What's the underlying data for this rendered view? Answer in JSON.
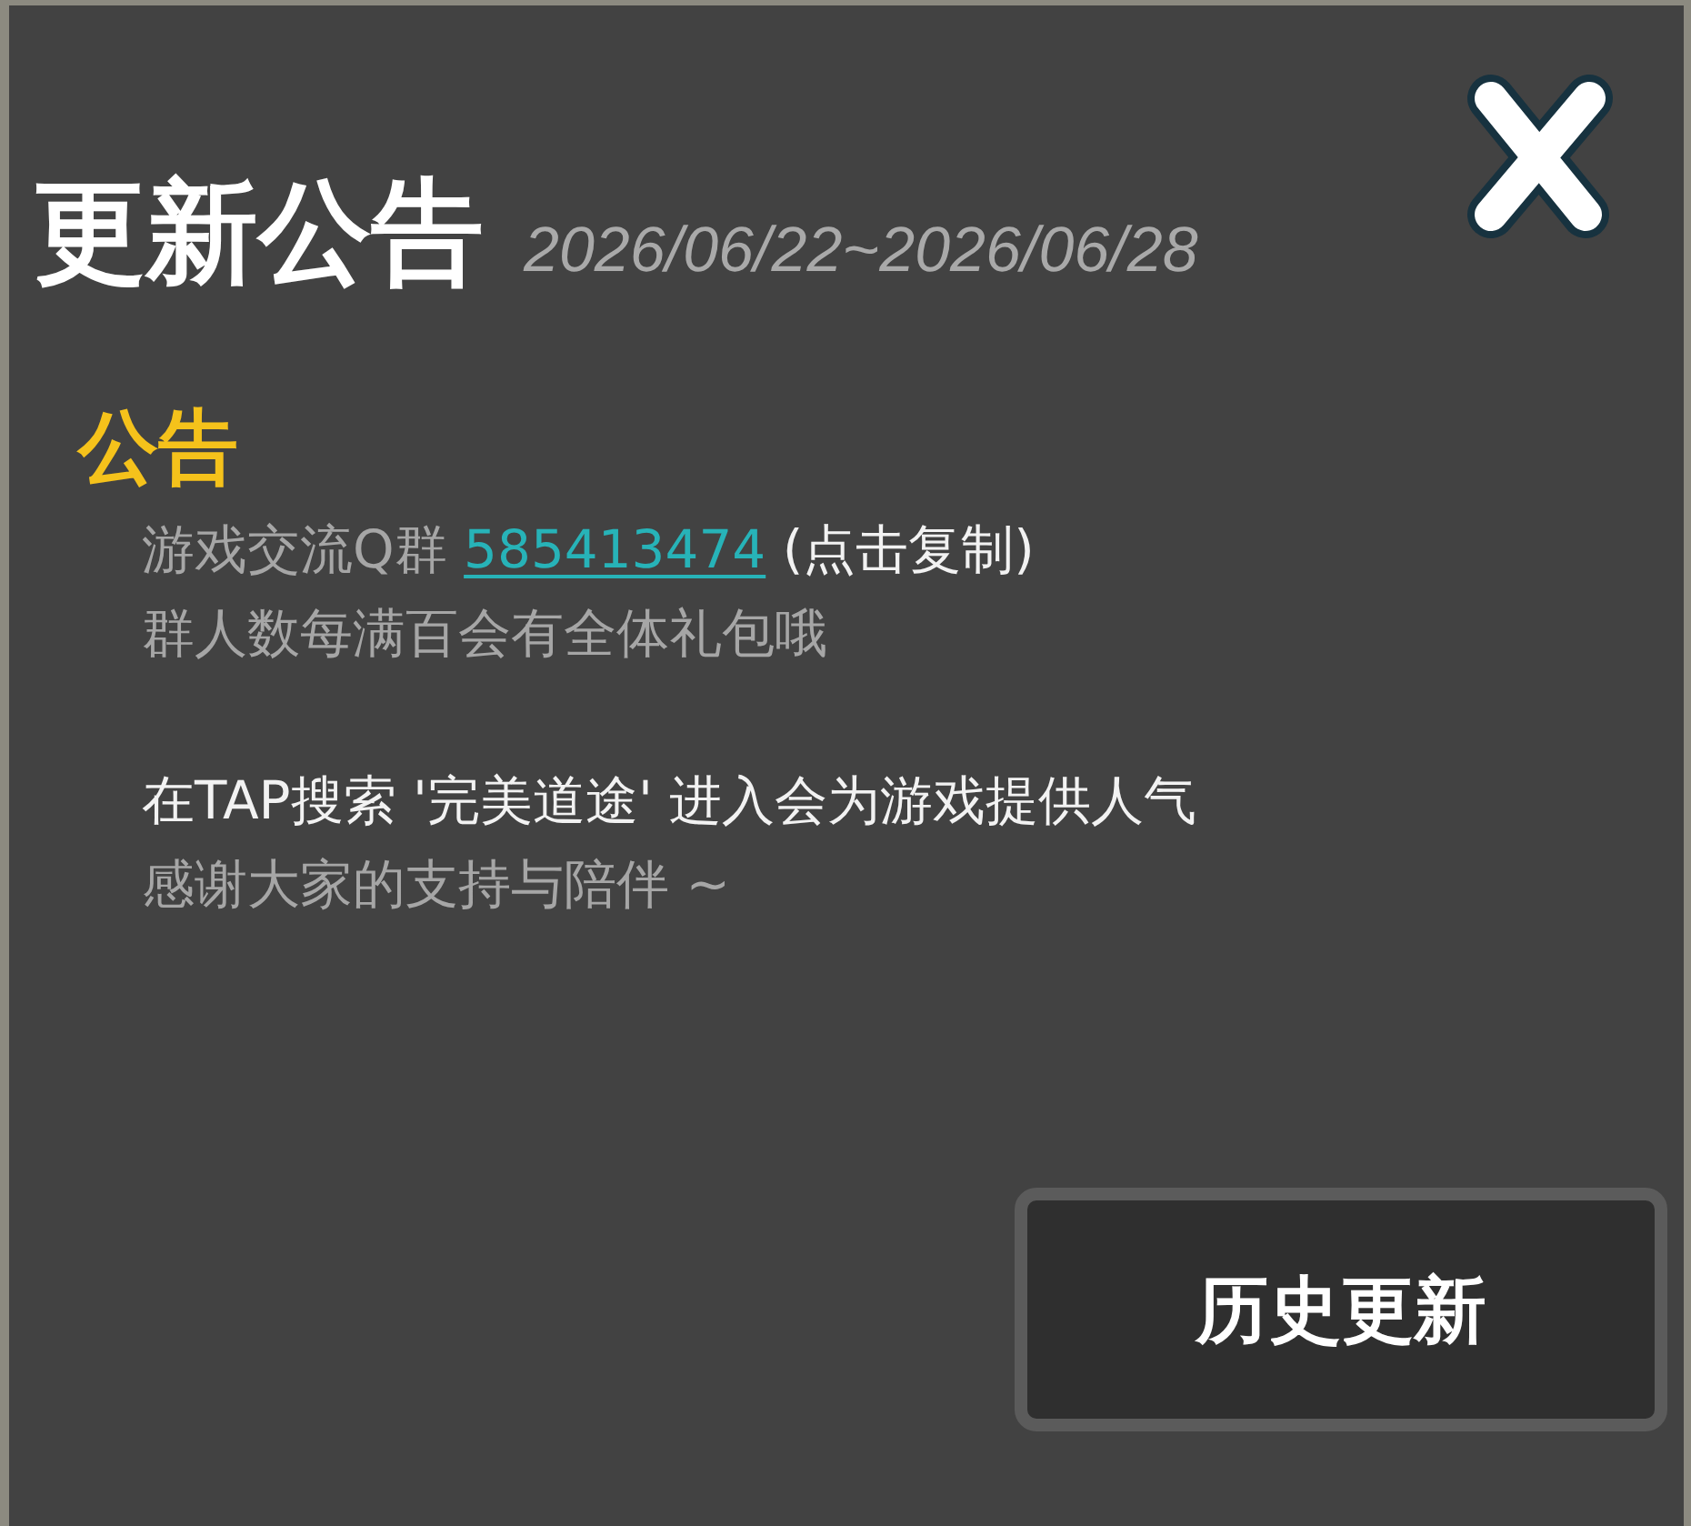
{
  "dialog": {
    "title": "更新公告",
    "date_range": "2026/06/22~2026/06/28"
  },
  "notice": {
    "heading": "公告",
    "paragraphs": [
      {
        "lines": [
          {
            "segments": [
              {
                "kind": "muted",
                "text": "游戏交流Q群"
              },
              {
                "kind": "link",
                "text": "585413474"
              },
              {
                "kind": "bright",
                "text": "(点击复制)"
              }
            ]
          },
          {
            "segments": [
              {
                "kind": "muted",
                "text": "群人数每满百会有全体礼包哦"
              }
            ]
          }
        ]
      },
      {
        "lines": [
          {
            "segments": [
              {
                "kind": "bright",
                "text": "在TAP搜索 '完美道途' 进入会为游戏提供人气"
              }
            ]
          },
          {
            "segments": [
              {
                "kind": "muted",
                "text": "感谢大家的支持与陪伴 ~"
              }
            ]
          }
        ]
      }
    ]
  },
  "footer": {
    "button": "历史更新"
  }
}
